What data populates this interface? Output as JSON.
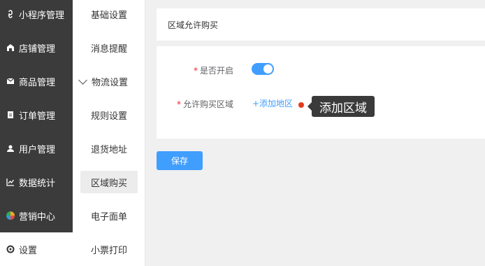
{
  "sidebar": {
    "items": [
      {
        "label": "小程序管理",
        "icon": "link-icon"
      },
      {
        "label": "店铺管理",
        "icon": "store-icon"
      },
      {
        "label": "商品管理",
        "icon": "mail-icon"
      },
      {
        "label": "订单管理",
        "icon": "order-icon"
      },
      {
        "label": "用户管理",
        "icon": "user-icon"
      },
      {
        "label": "数据统计",
        "icon": "chart-icon"
      },
      {
        "label": "营销中心",
        "icon": "marketing-icon"
      },
      {
        "label": "设置",
        "icon": "settings-icon",
        "active": true
      }
    ]
  },
  "subnav": {
    "items": [
      {
        "label": "基础设置"
      },
      {
        "label": "消息提醒"
      },
      {
        "label": "物流设置",
        "expanded": true,
        "icon": "chevron-down-icon"
      },
      {
        "label": "规则设置"
      },
      {
        "label": "退货地址"
      },
      {
        "label": "区域购买",
        "active": true
      },
      {
        "label": "电子面单"
      },
      {
        "label": "小票打印"
      }
    ]
  },
  "main": {
    "title": "区域允许购买",
    "form": {
      "enable_label": "是否开启",
      "enable_value": true,
      "region_label": "允许购买区域",
      "add_region_link": "+添加地区",
      "tooltip": "添加区域"
    },
    "save_label": "保存"
  },
  "colors": {
    "sidebar_bg": "#3b3b3b",
    "primary": "#409eff",
    "required": "#f5222d",
    "dot": "#e53a1e",
    "tooltip_bg": "#3a3a3a"
  }
}
